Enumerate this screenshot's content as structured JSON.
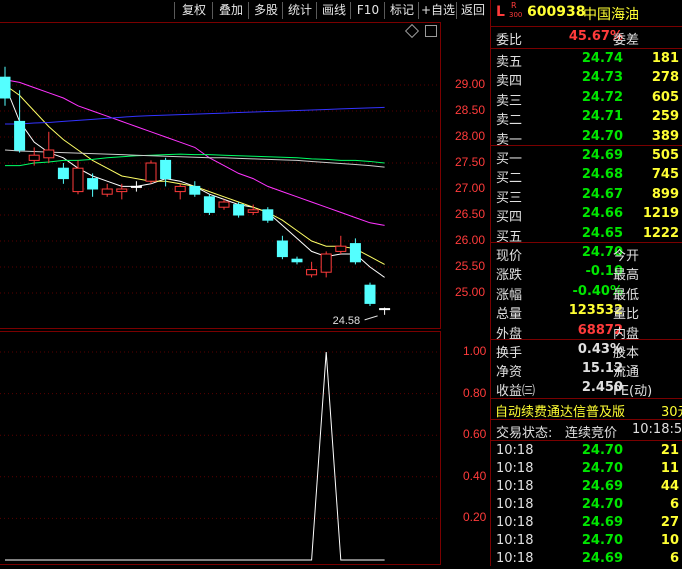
{
  "toolbar": {
    "buttons": [
      "复权",
      "叠加",
      "多股",
      "统计",
      "画线",
      "F10",
      "标记",
      "+自选",
      "返回"
    ]
  },
  "chart": {
    "price_axis": [
      "29.00",
      "28.50",
      "28.00",
      "27.50",
      "27.00",
      "26.50",
      "26.00",
      "25.50",
      "25.00"
    ],
    "low_marker": "24.58",
    "indicator_axis": [
      "1.00",
      "0.80",
      "0.60",
      "0.40",
      "0.20"
    ]
  },
  "chart_data": [
    {
      "type": "candlestick",
      "y_range": [
        24.6,
        29.3
      ],
      "candles": [
        {
          "o": 29.15,
          "c": 28.75,
          "h": 29.35,
          "l": 28.6
        },
        {
          "o": 28.3,
          "c": 27.75,
          "h": 28.9,
          "l": 27.7
        },
        {
          "o": 27.55,
          "c": 27.65,
          "h": 27.8,
          "l": 27.45
        },
        {
          "o": 27.6,
          "c": 27.75,
          "h": 28.1,
          "l": 27.5
        },
        {
          "o": 27.4,
          "c": 27.2,
          "h": 27.5,
          "l": 27.1
        },
        {
          "o": 26.95,
          "c": 27.4,
          "h": 27.55,
          "l": 26.9
        },
        {
          "o": 27.2,
          "c": 27.0,
          "h": 27.3,
          "l": 26.85
        },
        {
          "o": 26.9,
          "c": 27.0,
          "h": 27.1,
          "l": 26.85
        },
        {
          "o": 26.95,
          "c": 27.0,
          "h": 27.1,
          "l": 26.8
        },
        {
          "o": 27.05,
          "c": 27.05,
          "h": 27.15,
          "l": 26.95
        },
        {
          "o": 27.15,
          "c": 27.5,
          "h": 27.55,
          "l": 27.1
        },
        {
          "o": 27.55,
          "c": 27.2,
          "h": 27.6,
          "l": 27.05
        },
        {
          "o": 26.95,
          "c": 27.05,
          "h": 27.1,
          "l": 26.8
        },
        {
          "o": 27.05,
          "c": 26.9,
          "h": 27.15,
          "l": 26.85
        },
        {
          "o": 26.85,
          "c": 26.55,
          "h": 26.9,
          "l": 26.5
        },
        {
          "o": 26.65,
          "c": 26.75,
          "h": 26.8,
          "l": 26.6
        },
        {
          "o": 26.7,
          "c": 26.5,
          "h": 26.75,
          "l": 26.45
        },
        {
          "o": 26.55,
          "c": 26.6,
          "h": 26.7,
          "l": 26.5
        },
        {
          "o": 26.6,
          "c": 26.4,
          "h": 26.65,
          "l": 26.35
        },
        {
          "o": 26.0,
          "c": 25.7,
          "h": 26.1,
          "l": 25.65
        },
        {
          "o": 25.65,
          "c": 25.6,
          "h": 25.7,
          "l": 25.55
        },
        {
          "o": 25.35,
          "c": 25.45,
          "h": 25.6,
          "l": 25.3
        },
        {
          "o": 25.4,
          "c": 25.75,
          "h": 25.8,
          "l": 25.3
        },
        {
          "o": 25.8,
          "c": 25.9,
          "h": 26.1,
          "l": 25.75
        },
        {
          "o": 25.95,
          "c": 25.6,
          "h": 26.05,
          "l": 25.55
        },
        {
          "o": 25.15,
          "c": 24.8,
          "h": 25.2,
          "l": 24.75
        },
        {
          "o": 24.7,
          "c": 24.7,
          "h": 24.72,
          "l": 24.58
        }
      ],
      "ma_series": [
        {
          "color": "#ffffff",
          "values": [
            29.0,
            28.3,
            27.9,
            27.7,
            27.6,
            27.4,
            27.25,
            27.15,
            27.05,
            27.05,
            27.1,
            27.2,
            27.15,
            27.05,
            26.9,
            26.8,
            26.7,
            26.65,
            26.55,
            26.3,
            26.05,
            25.8,
            25.7,
            25.75,
            25.75,
            25.5,
            25.3
          ]
        },
        {
          "color": "#ffff66",
          "values": [
            29.0,
            28.8,
            28.5,
            28.2,
            27.95,
            27.75,
            27.55,
            27.4,
            27.25,
            27.2,
            27.15,
            27.15,
            27.1,
            27.05,
            26.95,
            26.85,
            26.75,
            26.65,
            26.55,
            26.4,
            26.2,
            26.0,
            25.9,
            25.9,
            25.85,
            25.7,
            25.55
          ]
        },
        {
          "color": "#ff33ff",
          "values": [
            29.1,
            29.05,
            28.95,
            28.85,
            28.75,
            28.6,
            28.5,
            28.4,
            28.3,
            28.2,
            28.1,
            28.0,
            27.9,
            27.8,
            27.6,
            27.45,
            27.3,
            27.2,
            27.05,
            26.95,
            26.85,
            26.75,
            26.65,
            26.55,
            26.45,
            26.35,
            26.3
          ]
        },
        {
          "color": "#00ff66",
          "values": [
            27.45,
            27.45,
            27.5,
            27.52,
            27.55,
            27.55,
            27.57,
            27.6,
            27.62,
            27.64,
            27.65,
            27.66,
            27.67,
            27.66,
            27.66,
            27.65,
            27.64,
            27.63,
            27.62,
            27.61,
            27.6,
            27.58,
            27.57,
            27.55,
            27.55,
            27.53,
            27.5
          ]
        },
        {
          "color": "#cccccc",
          "values": [
            27.75,
            27.73,
            27.72,
            27.71,
            27.7,
            27.69,
            27.68,
            27.67,
            27.66,
            27.65,
            27.64,
            27.63,
            27.62,
            27.61,
            27.6,
            27.6,
            27.59,
            27.58,
            27.57,
            27.56,
            27.55,
            27.53,
            27.51,
            27.49,
            27.47,
            27.45,
            27.42
          ]
        },
        {
          "color": "#3333ff",
          "values": [
            28.25,
            28.25,
            28.27,
            28.28,
            28.3,
            28.32,
            28.34,
            28.36,
            28.38,
            28.4,
            28.41,
            28.42,
            28.43,
            28.44,
            28.45,
            28.46,
            28.47,
            28.48,
            28.49,
            28.5,
            28.51,
            28.52,
            28.53,
            28.54,
            28.55,
            28.56,
            28.57
          ]
        }
      ]
    },
    {
      "type": "line",
      "y_range": [
        0,
        1.1
      ],
      "values": [
        0,
        0,
        0,
        0,
        0,
        0,
        0,
        0,
        0,
        0,
        0,
        0,
        0,
        0,
        0,
        0,
        0,
        0,
        0,
        0,
        0,
        0,
        1.0,
        0,
        0,
        0,
        0
      ]
    }
  ],
  "quote": {
    "title_prefix": "L",
    "title_badge_top": "R",
    "title_badge_bottom": "300",
    "code": "600938",
    "name": "中国海油",
    "weibi_label": "委比",
    "weibi_value": "45.67%",
    "weicha_label": "委差",
    "asks": [
      {
        "label": "卖五",
        "price": "24.74",
        "vol": "181"
      },
      {
        "label": "卖四",
        "price": "24.73",
        "vol": "278"
      },
      {
        "label": "卖三",
        "price": "24.72",
        "vol": "605"
      },
      {
        "label": "卖二",
        "price": "24.71",
        "vol": "259"
      },
      {
        "label": "卖一",
        "price": "24.70",
        "vol": "389"
      }
    ],
    "bids": [
      {
        "label": "买一",
        "price": "24.69",
        "vol": "505"
      },
      {
        "label": "买二",
        "price": "24.68",
        "vol": "745"
      },
      {
        "label": "买三",
        "price": "24.67",
        "vol": "899"
      },
      {
        "label": "买四",
        "price": "24.66",
        "vol": "1219"
      },
      {
        "label": "买五",
        "price": "24.65",
        "vol": "1222"
      }
    ],
    "stats": [
      {
        "label": "现价",
        "value": "24.70",
        "color": "green",
        "label2": "今开"
      },
      {
        "label": "涨跌",
        "value": "-0.10",
        "color": "green",
        "label2": "最高"
      },
      {
        "label": "涨幅",
        "value": "-0.40%",
        "color": "green",
        "label2": "最低"
      },
      {
        "label": "总量",
        "value": "123532",
        "color": "yellow",
        "label2": "量比"
      },
      {
        "label": "外盘",
        "value": "68872",
        "color": "red",
        "label2": "内盘"
      }
    ],
    "stats2": [
      {
        "label": "换手",
        "value": "0.43%",
        "label2": "股本"
      },
      {
        "label": "净资",
        "value": "15.12",
        "label2": "流通"
      },
      {
        "label": "收益㈢",
        "value": "2.450",
        "label2": "PE(动)"
      }
    ],
    "promo": "自动续费通达信普及版",
    "promo_tail": "30元",
    "status_label": "交易状态:",
    "status_value": "连续竞价",
    "status_time": "10:18:5",
    "ticks": [
      {
        "time": "10:18",
        "price": "24.70",
        "vol": "21"
      },
      {
        "time": "10:18",
        "price": "24.70",
        "vol": "11"
      },
      {
        "time": "10:18",
        "price": "24.69",
        "vol": "44"
      },
      {
        "time": "10:18",
        "price": "24.70",
        "vol": "6"
      },
      {
        "time": "10:18",
        "price": "24.69",
        "vol": "27"
      },
      {
        "time": "10:18",
        "price": "24.70",
        "vol": "10"
      },
      {
        "time": "10:18",
        "price": "24.69",
        "vol": "6"
      }
    ]
  }
}
